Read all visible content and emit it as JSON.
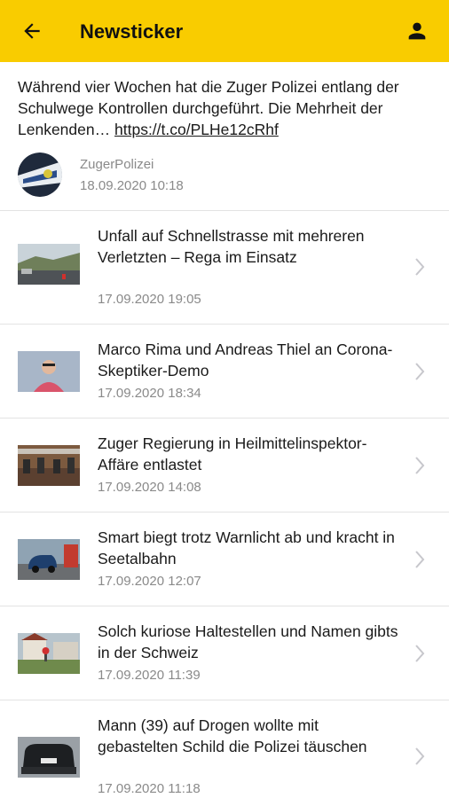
{
  "header": {
    "title": "Newsticker",
    "icons": {
      "back": "arrow-left-icon",
      "profile": "person-icon"
    },
    "color": "#f9cc00"
  },
  "tweet": {
    "text": "Während vier Wochen hat die Zuger Polizei entlang der Schulwege Kontrollen durchgeführt. Die Mehrheit der Lenkenden…",
    "link": "https://t.co/PLHe12cRhf",
    "author": "ZugerPolizei",
    "date": "18.09.2020 10:18"
  },
  "news": [
    {
      "title": "Unfall auf Schnellstrasse mit mehreren Verletzten – Rega im Einsatz",
      "date": "17.09.2020 19:05"
    },
    {
      "title": "Marco Rima und Andreas Thiel an Corona-Skeptiker-Demo",
      "date": "17.09.2020 18:34"
    },
    {
      "title": "Zuger Regierung in Heilmittelinspektor-Affäre entlastet",
      "date": "17.09.2020 14:08"
    },
    {
      "title": "Smart biegt trotz Warnlicht ab und kracht in Seetalbahn",
      "date": "17.09.2020 12:07"
    },
    {
      "title": "Solch kuriose Haltestellen und Namen gibts in der Schweiz",
      "date": "17.09.2020 11:39"
    },
    {
      "title": "Mann (39) auf Drogen wollte mit gebastelten Schild die Polizei täuschen",
      "date": "17.09.2020 11:18"
    }
  ]
}
